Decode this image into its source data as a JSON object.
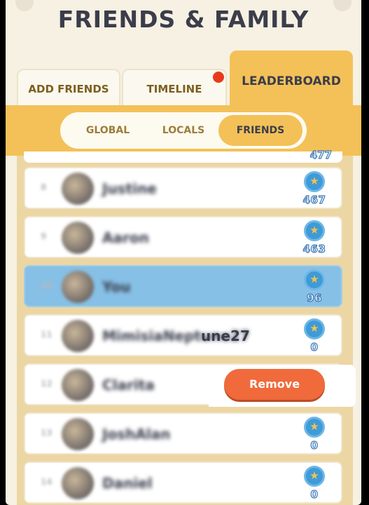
{
  "header": {
    "title": "FRIENDS & FAMILY"
  },
  "tabs": [
    {
      "label": "ADD FRIENDS"
    },
    {
      "label": "TIMELINE"
    },
    {
      "label": "LEADERBOARD"
    }
  ],
  "segments": [
    {
      "label": "GLOBAL"
    },
    {
      "label": "LOCALS"
    },
    {
      "label": "FRIENDS"
    }
  ],
  "list": {
    "top_partial_score": "477",
    "rows": [
      {
        "rank": "8",
        "name": "Justine",
        "score": "467"
      },
      {
        "rank": "9",
        "name": "Aaron",
        "score": "463"
      },
      {
        "rank": "10",
        "name": "You",
        "score": "96"
      },
      {
        "rank": "11",
        "name": "MimisiaNeptune27",
        "name_visible_tail": "une27",
        "score": "0"
      },
      {
        "rank": "12",
        "name": "Clarita",
        "remove_label": "Remove"
      },
      {
        "rank": "13",
        "name": "JoshAlan",
        "score": "0"
      },
      {
        "rank": "14",
        "name": "Daniel",
        "score": "0"
      }
    ]
  }
}
